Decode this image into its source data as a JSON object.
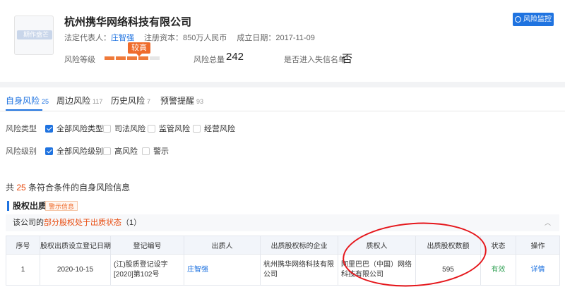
{
  "company": {
    "logo_text": "期作盘芒",
    "name": "杭州携华网络科技有限公司",
    "legal_rep_label": "法定代表人：",
    "legal_rep": "庄智强",
    "capital_label": "注册资本：",
    "capital": "850万人民币",
    "founded_label": "成立日期：",
    "founded": "2017-11-09",
    "risk_level_label": "风险等级",
    "risk_level": "较高",
    "risk_level_filled": 4,
    "risk_level_total": 5,
    "risk_total_label": "风险总量",
    "risk_total": "242",
    "blacklist_label": "是否进入失信名单",
    "blacklist_value": "否",
    "monitor_button": "风险监控"
  },
  "tabs": [
    {
      "label": "自身风险",
      "count": "25"
    },
    {
      "label": "周边风险",
      "count": "117"
    },
    {
      "label": "历史风险",
      "count": "7"
    },
    {
      "label": "预警提醒",
      "count": "93"
    }
  ],
  "filters": {
    "risk_type": {
      "label": "风险类型",
      "options": [
        {
          "label": "全部风险类型",
          "checked": true
        },
        {
          "label": "司法风险",
          "checked": false
        },
        {
          "label": "监管风险",
          "checked": false
        },
        {
          "label": "经营风险",
          "checked": false
        }
      ]
    },
    "risk_level": {
      "label": "风险级别",
      "options": [
        {
          "label": "全部风险级别",
          "checked": true
        },
        {
          "label": "高风险",
          "checked": false
        },
        {
          "label": "警示",
          "checked": false
        }
      ]
    }
  },
  "summary": {
    "prefix": "共",
    "count": "25",
    "suffix": "条符合条件的自身风险信息"
  },
  "section": {
    "title": "股权出质",
    "tag": "警示信息",
    "status_prefix": "该公司的",
    "status_highlight": "部分股权处于出质状态",
    "status_suffix": "（1）",
    "collapse_icon": "chevron-up-icon"
  },
  "table": {
    "headers": [
      "序号",
      "股权出质设立登记日期",
      "登记编号",
      "出质人",
      "出质股权标的企业",
      "质权人",
      "出质股权数额",
      "状态",
      "操作"
    ],
    "rows": [
      {
        "index": "1",
        "date": "2020-10-15",
        "reg_no": "(江)股质登记设字[2020]第102号",
        "pledgor": "庄智强",
        "target": "杭州携华网络科技有限公司",
        "pledgee": "阿里巴巴（中国）网络科技有限公司",
        "amount": "595",
        "status": "有效",
        "action": "详情"
      }
    ]
  },
  "colors": {
    "accent": "#1f73e0",
    "risk": "#ef6b2b",
    "highlight": "#e8490c",
    "valid": "#3ba55c",
    "annotation": "#e5161b"
  }
}
